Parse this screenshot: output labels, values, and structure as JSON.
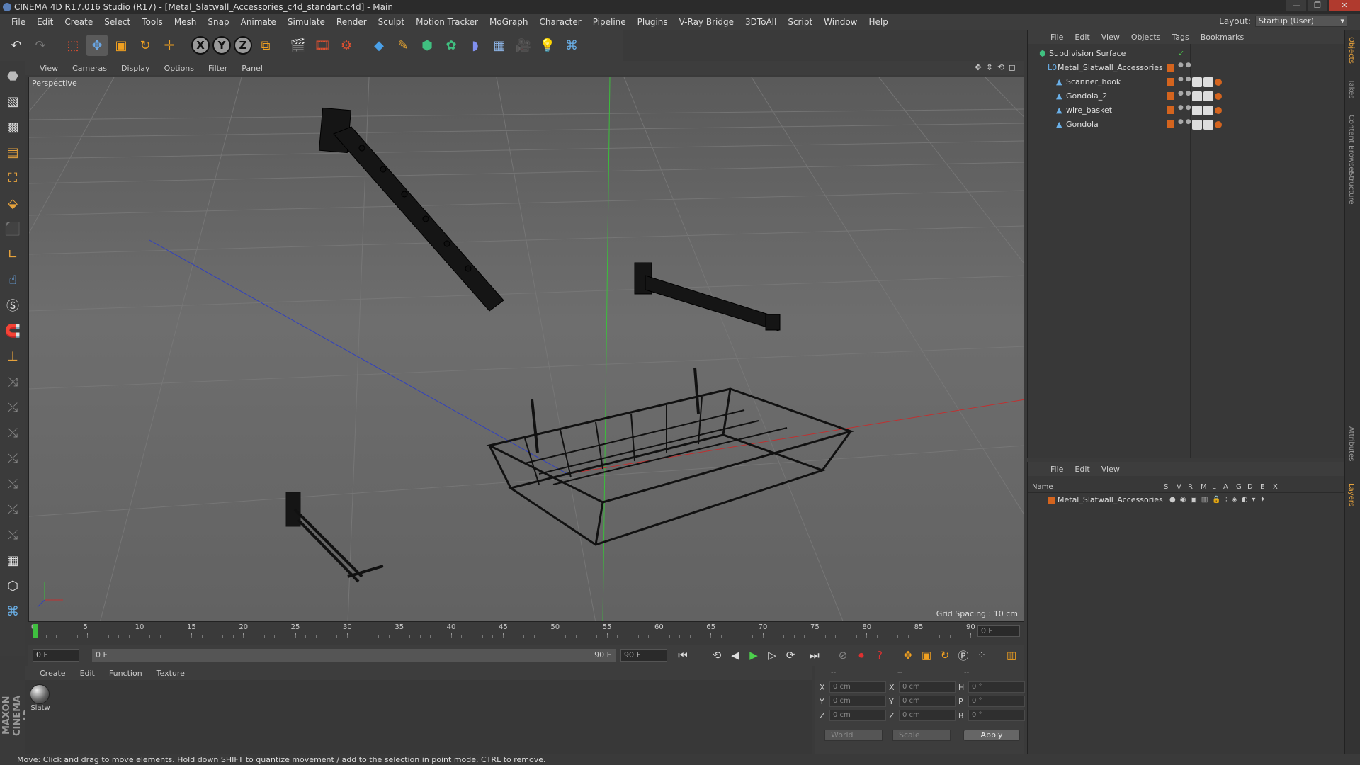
{
  "window": {
    "title": "CINEMA 4D R17.016 Studio (R17) - [Metal_Slatwall_Accessories_c4d_standart.c4d] - Main",
    "buttons": [
      "—",
      "❐",
      "✕"
    ]
  },
  "menu": {
    "items": [
      "File",
      "Edit",
      "Create",
      "Select",
      "Tools",
      "Mesh",
      "Snap",
      "Animate",
      "Simulate",
      "Render",
      "Sculpt",
      "Motion Tracker",
      "MoGraph",
      "Character",
      "Pipeline",
      "Plugins",
      "V-Ray Bridge",
      "3DToAll",
      "Script",
      "Window",
      "Help"
    ],
    "layout_label": "Layout:",
    "layout_value": "Startup (User)"
  },
  "viewport": {
    "menu": [
      "View",
      "Cameras",
      "Display",
      "Options",
      "Filter",
      "Panel"
    ],
    "label": "Perspective",
    "grid_spacing": "Grid Spacing : 10 cm"
  },
  "timeline": {
    "ticks": [
      "0",
      "5",
      "10",
      "15",
      "20",
      "25",
      "30",
      "35",
      "40",
      "45",
      "50",
      "55",
      "60",
      "65",
      "70",
      "75",
      "80",
      "85",
      "90"
    ],
    "current_frame": "0 F"
  },
  "playbar": {
    "start_field": "0 F",
    "range_start": "0 F",
    "range_end": "90 F",
    "end_field": "90 F"
  },
  "material_manager": {
    "menu": [
      "Create",
      "Edit",
      "Function",
      "Texture"
    ],
    "materials": [
      {
        "name": "Slatw"
      }
    ]
  },
  "coordinates": {
    "headers": [
      "--",
      "--",
      "--"
    ],
    "rows": [
      {
        "l1": "X",
        "v1": "0 cm",
        "l2": "X",
        "v2": "0 cm",
        "l3": "H",
        "v3": "0 °"
      },
      {
        "l1": "Y",
        "v1": "0 cm",
        "l2": "Y",
        "v2": "0 cm",
        "l3": "P",
        "v3": "0 °"
      },
      {
        "l1": "Z",
        "v1": "0 cm",
        "l2": "Z",
        "v2": "0 cm",
        "l3": "B",
        "v3": "0 °"
      }
    ],
    "mode1": "World",
    "mode2": "Scale",
    "apply": "Apply"
  },
  "object_manager": {
    "menu": [
      "File",
      "Edit",
      "View",
      "Objects",
      "Tags",
      "Bookmarks"
    ],
    "objects": [
      {
        "name": "Subdivision Surface"
      },
      {
        "name": "Metal_Slatwall_Accessories"
      },
      {
        "name": "Scanner_hook"
      },
      {
        "name": "Gondola_2"
      },
      {
        "name": "wire_basket"
      },
      {
        "name": "Gondola"
      }
    ]
  },
  "layer_manager": {
    "menu": [
      "File",
      "Edit",
      "View"
    ],
    "columns": [
      "Name",
      "S",
      "V",
      "R",
      "M",
      "L",
      "A",
      "G",
      "D",
      "E",
      "X"
    ],
    "layers": [
      {
        "name": "Metal_Slatwall_Accessories"
      }
    ]
  },
  "side_tabs": [
    "Objects",
    "Takes",
    "Content Browser",
    "Structure",
    "Attributes",
    "Layers"
  ],
  "status": "Move: Click and drag to move elements. Hold down SHIFT to quantize movement / add to the selection in point mode, CTRL to remove."
}
